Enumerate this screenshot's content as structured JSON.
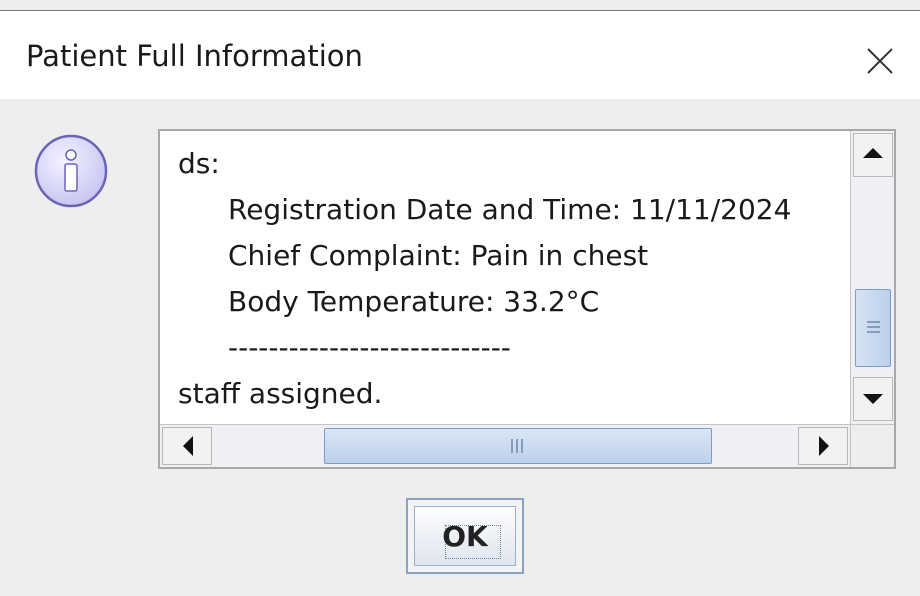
{
  "dialog": {
    "title": "Patient Full Information",
    "close_icon": "close-icon",
    "message_icon": "info-icon"
  },
  "message": {
    "lines": [
      "ds:",
      "Registration Date and Time: 11/11/2024",
      "Chief Complaint: Pain in chest",
      "Body Temperature: 33.2°C",
      "----------------------------",
      "staff assigned."
    ]
  },
  "scrollbars": {
    "vertical": {
      "up_icon": "arrow-up-icon",
      "down_icon": "arrow-down-icon",
      "grip_icon": "grip-icon"
    },
    "horizontal": {
      "left_icon": "arrow-left-icon",
      "right_icon": "arrow-right-icon",
      "grip_icon": "grip-icon"
    }
  },
  "buttons": {
    "ok_label": "OK"
  },
  "colors": {
    "info_icon_fill": "#c9c6f2",
    "info_icon_border": "#6a64b8",
    "scroll_thumb": "#bcd0ea"
  }
}
